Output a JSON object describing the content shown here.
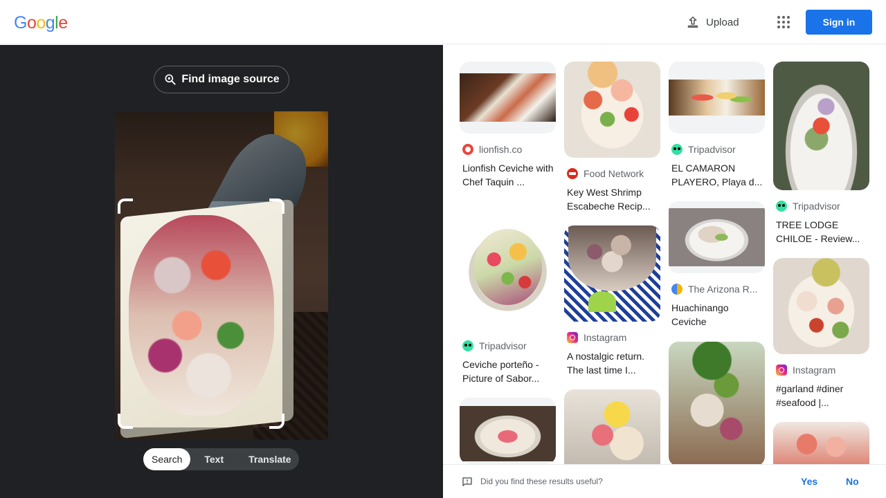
{
  "header": {
    "logo_letters": [
      {
        "ch": "G",
        "color": "#4285F4"
      },
      {
        "ch": "o",
        "color": "#EA4335"
      },
      {
        "ch": "o",
        "color": "#FBBC05"
      },
      {
        "ch": "g",
        "color": "#4285F4"
      },
      {
        "ch": "l",
        "color": "#34A853"
      },
      {
        "ch": "e",
        "color": "#EA4335"
      }
    ],
    "upload_label": "Upload",
    "signin_label": "Sign in"
  },
  "query": {
    "find_source_label": "Find image source",
    "modes": [
      "Search",
      "Text",
      "Translate"
    ],
    "active_mode": "Search"
  },
  "results": [
    {
      "source": "lionfish.co",
      "favicon": "lionfish-icon",
      "title": "Lionfish Ceviche with Chef Taquin ..."
    },
    {
      "source": "Food Network",
      "favicon": "food-network-icon",
      "title": "Key West Shrimp Escabeche Recip..."
    },
    {
      "source": "Tripadvisor",
      "favicon": "tripadvisor-icon",
      "title": "EL CAMARON PLAYERO, Playa d..."
    },
    {
      "source": "Tripadvisor",
      "favicon": "tripadvisor-icon",
      "title": "TREE LODGE CHILOE - Review..."
    },
    {
      "source": "Tripadvisor",
      "favicon": "tripadvisor-icon",
      "title": "Ceviche porteño - Picture of Sabor..."
    },
    {
      "source": "Instagram",
      "favicon": "instagram-icon",
      "title": "A nostalgic return. The last time I..."
    },
    {
      "source": "The Arizona R...",
      "favicon": "arizona-icon",
      "title": "Huachinango Ceviche"
    },
    {
      "source": "Instagram",
      "favicon": "instagram-icon",
      "title": "#garland #diner #seafood |..."
    }
  ],
  "feedback": {
    "question": "Did you find these results useful?",
    "yes_label": "Yes",
    "no_label": "No"
  },
  "colors": {
    "accent": "#1a73e8",
    "dark_panel": "#202124"
  }
}
